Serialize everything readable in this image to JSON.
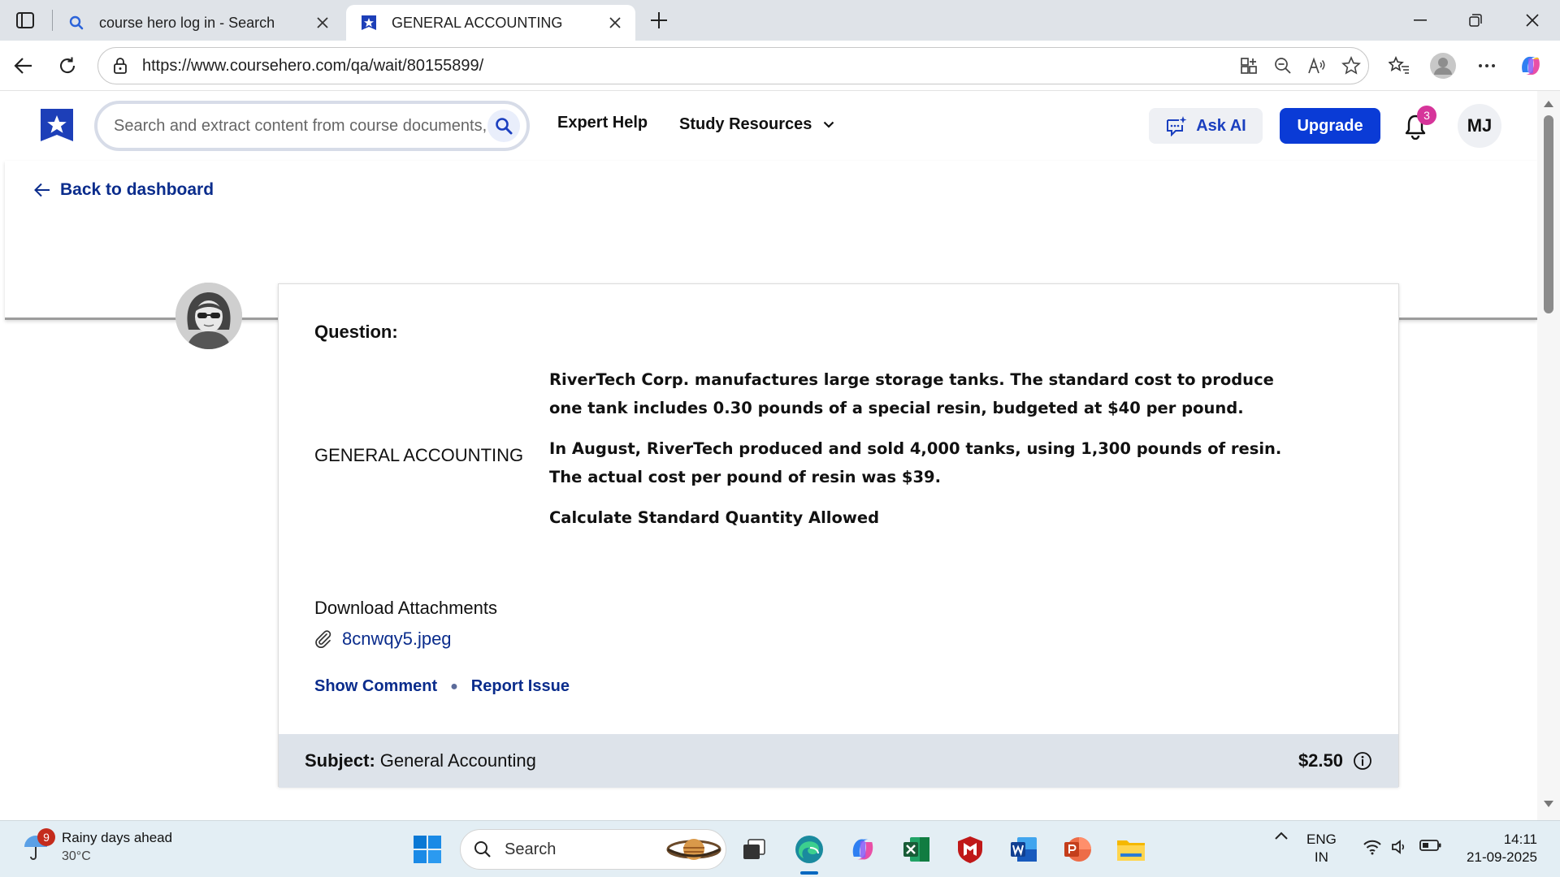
{
  "browser": {
    "tabs": [
      {
        "title": "course hero log in - Search",
        "icon": "search-icon",
        "active": false
      },
      {
        "title": "GENERAL ACCOUNTING",
        "icon": "coursehero-icon",
        "active": true
      }
    ],
    "url": "https://www.coursehero.com/qa/wait/80155899/"
  },
  "header": {
    "search_placeholder": "Search and extract content from course documents, ...",
    "nav": {
      "expert_help": "Expert Help",
      "study_resources": "Study Resources"
    },
    "ask_ai": "Ask AI",
    "upgrade": "Upgrade",
    "notification_count": "3",
    "user_initials": "MJ"
  },
  "back_link": "Back to dashboard",
  "question": {
    "label": "Question:",
    "subject_heading": "GENERAL ACCOUNTING",
    "paragraphs": [
      "RiverTech Corp. manufactures large storage tanks. The standard cost to produce one tank includes 0.30 pounds of a special resin, budgeted at $40 per pound.",
      "In August, RiverTech produced and sold 4,000 tanks, using 1,300 pounds of resin. The actual cost per pound of resin was $39.",
      "Calculate Standard Quantity Allowed"
    ],
    "attachments_label": "Download Attachments",
    "attachment_file": "8cnwqy5.jpeg",
    "show_comment": "Show Comment",
    "report_issue": "Report Issue",
    "footer": {
      "subject_key": "Subject:",
      "subject_value": "General Accounting",
      "price": "$2.50"
    }
  },
  "taskbar": {
    "weather_badge": "9",
    "weather_text": "Rainy days ahead",
    "temperature": "30°C",
    "search_label": "Search",
    "lang_top": "ENG",
    "lang_bottom": "IN",
    "time": "14:11",
    "date": "21-09-2025"
  },
  "colors": {
    "brand_blue": "#0a3bd6",
    "link_blue": "#0a2c8c",
    "badge_pink": "#d6359a",
    "footer_gray": "#dde3ea"
  }
}
